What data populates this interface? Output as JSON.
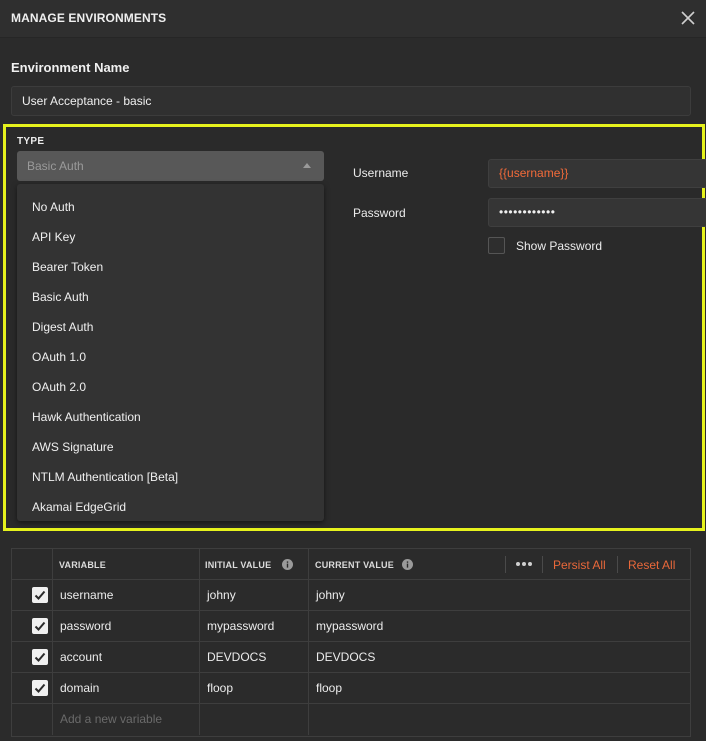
{
  "header": {
    "title": "MANAGE ENVIRONMENTS"
  },
  "environment": {
    "label": "Environment Name",
    "value": "User Acceptance - basic"
  },
  "auth": {
    "type_label": "TYPE",
    "selected": "Basic Auth",
    "options": [
      "No Auth",
      "API Key",
      "Bearer Token",
      "Basic Auth",
      "Digest Auth",
      "OAuth 1.0",
      "OAuth 2.0",
      "Hawk Authentication",
      "AWS Signature",
      "NTLM Authentication [Beta]",
      "Akamai EdgeGrid"
    ],
    "username_label": "Username",
    "username_value": "{{username}}",
    "password_label": "Password",
    "password_value": "••••••••••••",
    "show_password_label": "Show Password",
    "show_password_checked": false
  },
  "variables": {
    "headers": {
      "variable": "VARIABLE",
      "initial": "INITIAL VALUE",
      "current": "CURRENT VALUE"
    },
    "more_icon": "more-horizontal-icon",
    "persist_all": "Persist All",
    "reset_all": "Reset All",
    "rows": [
      {
        "checked": true,
        "name": "username",
        "initial": "johny",
        "current": "johny"
      },
      {
        "checked": true,
        "name": "password",
        "initial": "mypassword",
        "current": "mypassword"
      },
      {
        "checked": true,
        "name": "account",
        "initial": "DEVDOCS",
        "current": "DEVDOCS"
      },
      {
        "checked": true,
        "name": "domain",
        "initial": "floop",
        "current": "floop"
      }
    ],
    "new_placeholder": "Add a new variable"
  },
  "colors": {
    "accent": "#e9683a",
    "highlight_border": "#e6f21d",
    "background": "#2b2b2b"
  }
}
